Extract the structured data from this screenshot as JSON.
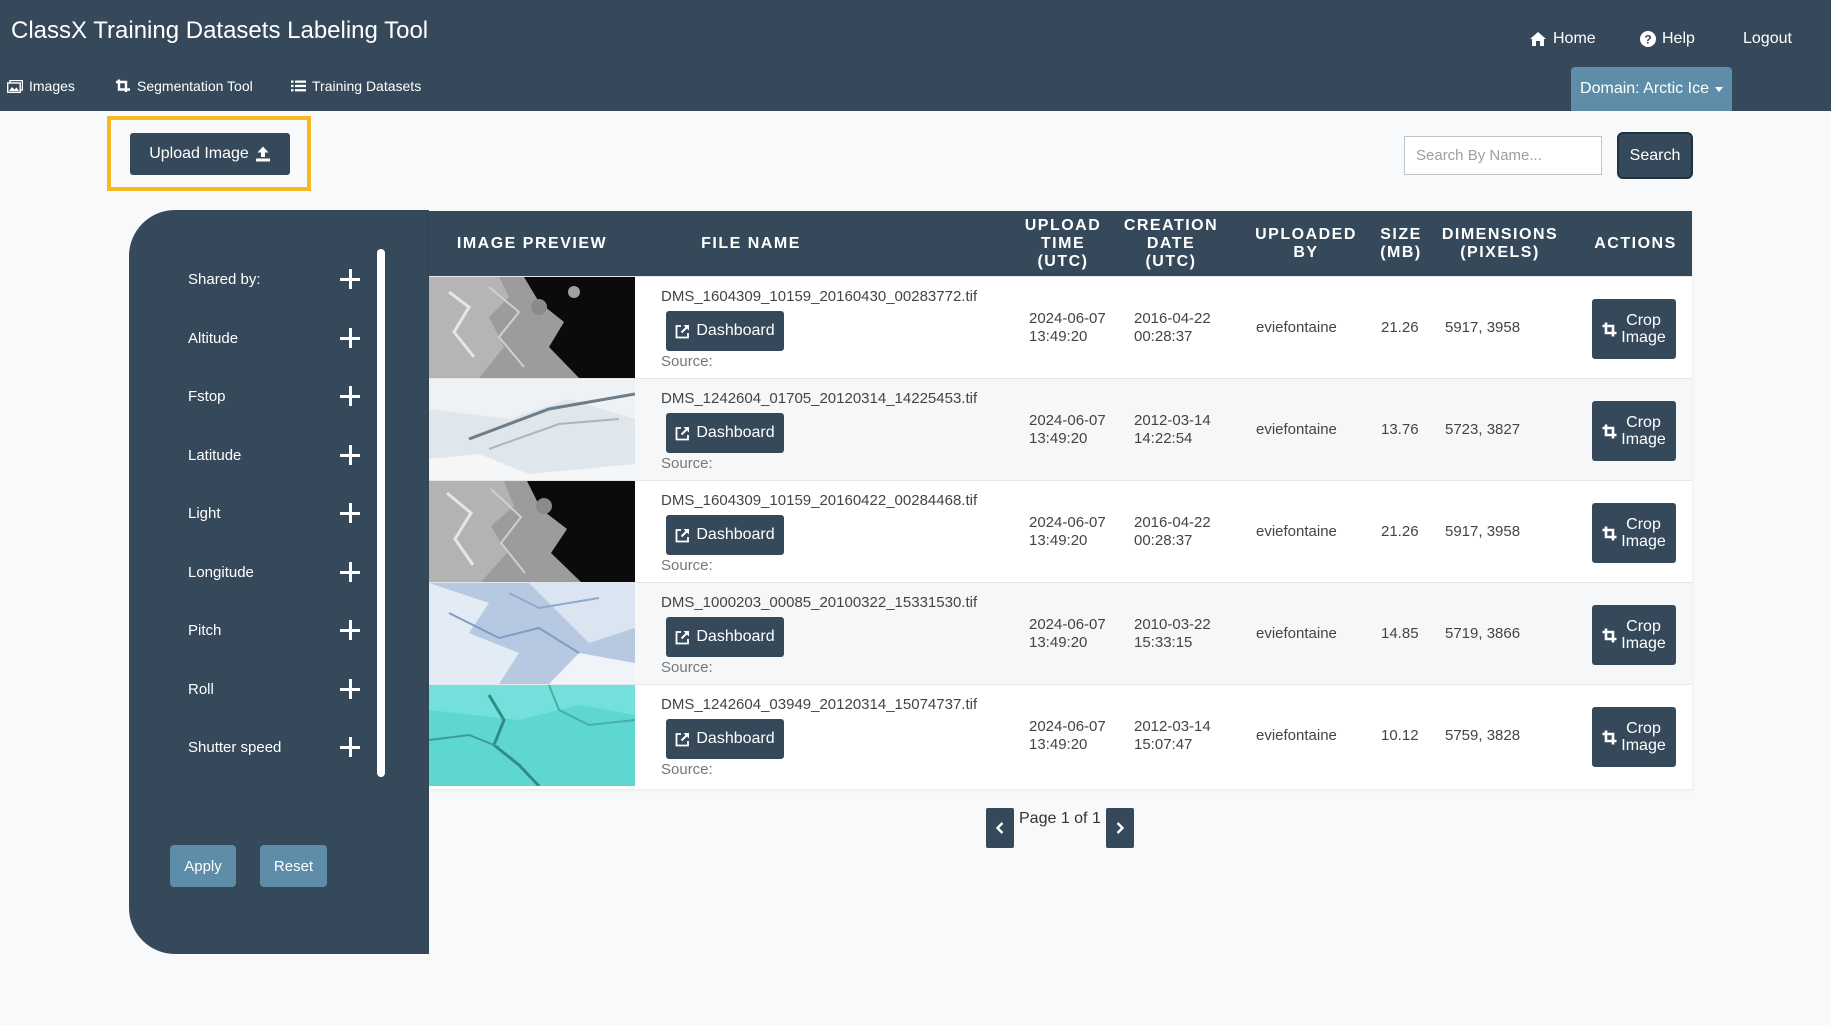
{
  "app_title": "ClassX Training Datasets Labeling Tool",
  "top_links": {
    "home": "Home",
    "help": "Help",
    "logout": "Logout"
  },
  "nav": {
    "images": "Images",
    "segmentation": "Segmentation Tool",
    "training": "Training Datasets"
  },
  "domain_button": "Domain: Arctic Ice",
  "upload_label": "Upload Image",
  "search": {
    "placeholder": "Search By Name...",
    "button": "Search"
  },
  "filters": {
    "items": [
      "Shared by:",
      "Altitude",
      "Fstop",
      "Latitude",
      "Light",
      "Longitude",
      "Pitch",
      "Roll",
      "Shutter speed"
    ],
    "apply": "Apply",
    "reset": "Reset"
  },
  "table": {
    "headers": [
      "IMAGE PREVIEW",
      "FILE NAME",
      "UPLOAD\nTIME\n(UTC)",
      "CREATION\nDATE\n(UTC)",
      "UPLOADED\nBY",
      "SIZE\n(MB)",
      "DIMENSIONS\n(PIXELS)",
      "ACTIONS"
    ],
    "dashboard_label": "Dashboard",
    "source_label": "Source:",
    "crop_line1": "Crop",
    "crop_line2": "Image",
    "rows": [
      {
        "file": "DMS_1604309_10159_20160430_00283772.tif",
        "upload_date": "2024-06-07",
        "upload_time": "13:49:20",
        "creation_date": "2016-04-22",
        "creation_time": "00:28:37",
        "by": "eviefontaine",
        "size": "21.26",
        "dims": "5917, 3958"
      },
      {
        "file": "DMS_1242604_01705_20120314_14225453.tif",
        "upload_date": "2024-06-07",
        "upload_time": "13:49:20",
        "creation_date": "2012-03-14",
        "creation_time": "14:22:54",
        "by": "eviefontaine",
        "size": "13.76",
        "dims": "5723, 3827"
      },
      {
        "file": "DMS_1604309_10159_20160422_00284468.tif",
        "upload_date": "2024-06-07",
        "upload_time": "13:49:20",
        "creation_date": "2016-04-22",
        "creation_time": "00:28:37",
        "by": "eviefontaine",
        "size": "21.26",
        "dims": "5917, 3958"
      },
      {
        "file": "DMS_1000203_00085_20100322_15331530.tif",
        "upload_date": "2024-06-07",
        "upload_time": "13:49:20",
        "creation_date": "2010-03-22",
        "creation_time": "15:33:15",
        "by": "eviefontaine",
        "size": "14.85",
        "dims": "5719, 3866"
      },
      {
        "file": "DMS_1242604_03949_20120314_15074737.tif",
        "upload_date": "2024-06-07",
        "upload_time": "13:49:20",
        "creation_date": "2012-03-14",
        "creation_time": "15:07:47",
        "by": "eviefontaine",
        "size": "10.12",
        "dims": "5759, 3828"
      }
    ]
  },
  "pagination": {
    "text": "Page 1 of 1"
  },
  "colors": {
    "header": "#35495a",
    "accent": "#5d8da8",
    "highlight": "#f5b822"
  },
  "icons": {
    "home": "home-icon",
    "help": "help-icon",
    "upload": "upload-icon",
    "dashboard": "external-link-icon",
    "crop": "crop-icon"
  }
}
